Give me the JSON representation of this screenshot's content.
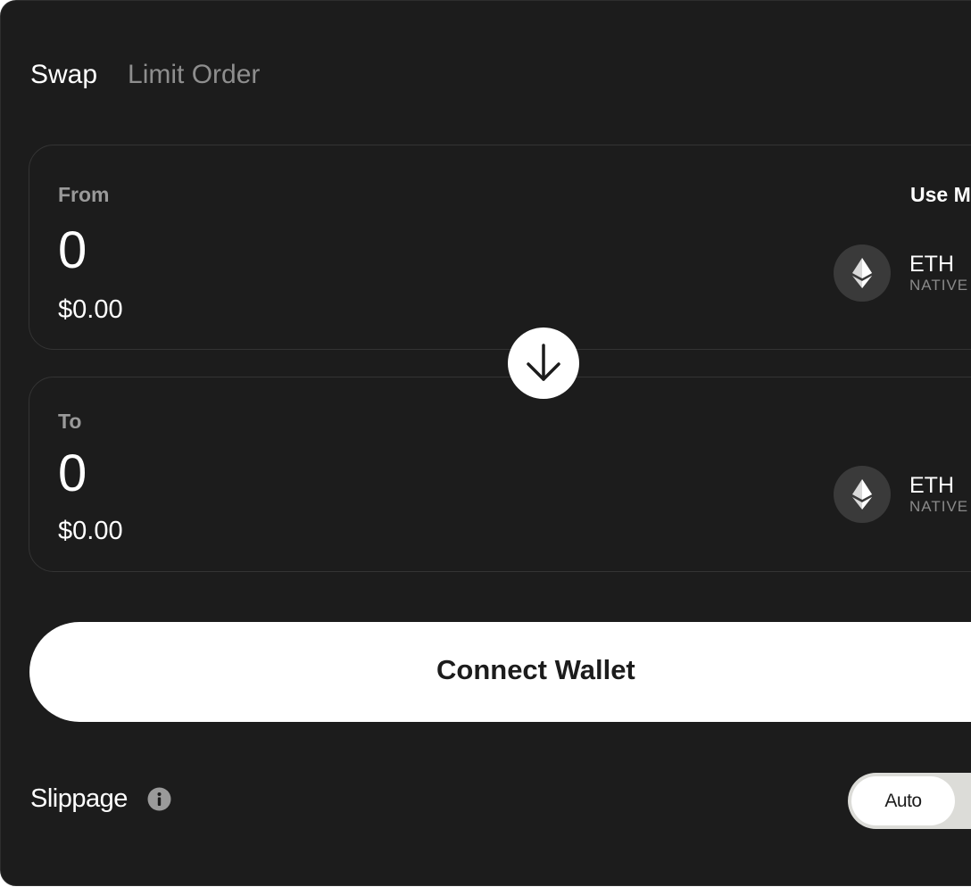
{
  "tabs": [
    {
      "label": "Swap",
      "active": true
    },
    {
      "label": "Limit Order",
      "active": false
    }
  ],
  "from": {
    "label": "From",
    "amount": "0",
    "usd": "$0.00",
    "max_label": "Use M",
    "token": {
      "symbol": "ETH",
      "network": "NATIVE",
      "icon": "ethereum-icon"
    }
  },
  "to": {
    "label": "To",
    "amount": "0",
    "usd": "$0.00",
    "token": {
      "symbol": "ETH",
      "network": "NATIVE",
      "icon": "ethereum-icon"
    }
  },
  "swap_direction_icon": "arrow-down-icon",
  "connect_button": {
    "label": "Connect Wallet"
  },
  "slippage": {
    "label": "Slippage",
    "info_icon": "info-icon",
    "mode": "Auto"
  },
  "colors": {
    "panel_bg": "#1c1c1c",
    "card_border": "#343434",
    "primary_text": "#ffffff",
    "muted_text": "#8e8e8e",
    "button_bg": "#ffffff",
    "button_text": "#1c1c1c",
    "token_icon_bg": "#3a3a3a"
  }
}
